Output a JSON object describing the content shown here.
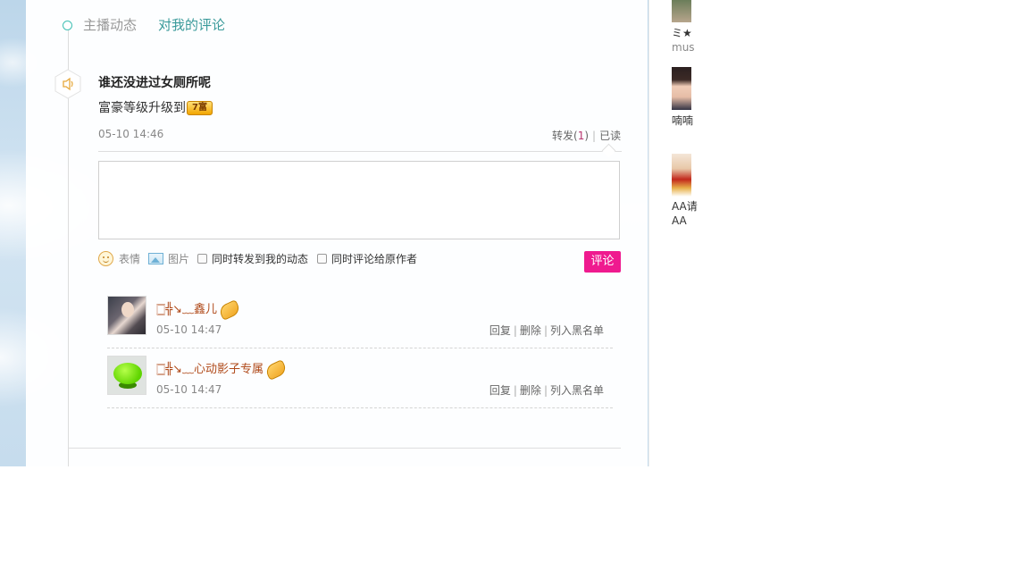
{
  "tabs": [
    {
      "label": "主播动态"
    },
    {
      "label": "对我的评论"
    }
  ],
  "post": {
    "title": "谁还没进过女厕所呢",
    "line": "富豪等级升级到",
    "badge": "7富",
    "time": "05-10 14:46",
    "forward_label": "转发(",
    "forward_count": "1",
    "forward_close": ")",
    "read_label": "已读"
  },
  "comment_form": {
    "placeholder": "",
    "emoji_label": "表情",
    "image_label": "图片",
    "repost_checkbox": "同时转发到我的动态",
    "comment_author_checkbox": "同时评论给原作者",
    "submit_label": "评论"
  },
  "replies": [
    {
      "username": "🀆╬↘﹏鑫儿",
      "time": "05-10 14:47",
      "reply": "回复",
      "delete": "删除",
      "blacklist": "列入黑名单"
    },
    {
      "username": "🀆╬↘﹏心动影子专属",
      "time": "05-10 14:47",
      "reply": "回复",
      "delete": "删除",
      "blacklist": "列入黑名单"
    }
  ],
  "right_column": {
    "user1_name": "ミ★",
    "user1_sub": "mus",
    "user2_name": "喃喃",
    "user3_name": "AA请",
    "user3_sub": "AA"
  },
  "colors": {
    "accent_teal": "#3a9a9a",
    "button_pink": "#ef1a8f",
    "count_color": "#b83670"
  }
}
